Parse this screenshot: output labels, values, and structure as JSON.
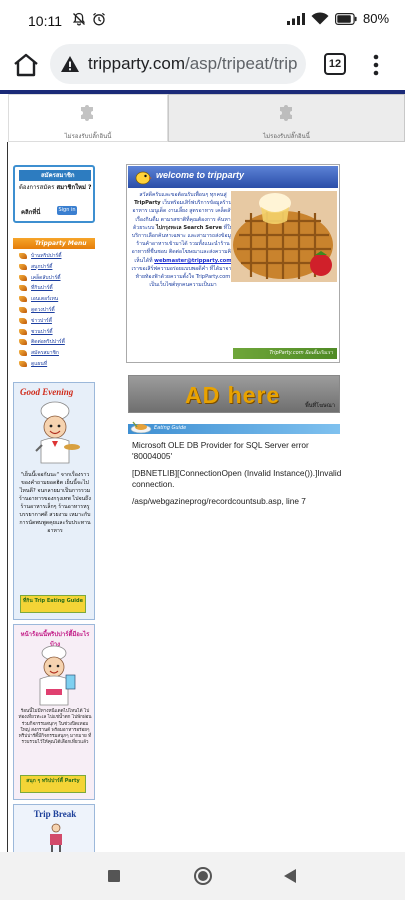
{
  "status_bar": {
    "time": "10:11",
    "battery": "80"
  },
  "browser": {
    "url_host": "tripparty.com",
    "url_path": "/asp/tripeat/trip",
    "tab_count": "12"
  },
  "plugin_notice": {
    "left": "ไม่รองรับปลั๊กอินนี้",
    "right": "ไม่รองรับปลั๊กอินนี้"
  },
  "member": {
    "title": "สมัครสมาชิก",
    "line": "ต้องการสมัคร",
    "line_bold": "สมาชิกใหม่ ?",
    "click": "คลิกที่นี่",
    "signin": "Sign in"
  },
  "menu": {
    "header": "Tripparty Menu",
    "items": [
      "บ้านทริปปาร์ตี้",
      "สนุกปาร์ตี้",
      "เคล็ดลับปาร์ตี้",
      "ที่กินปาร์ตี้",
      "เอนเตอร์เทน",
      "ดูดวงปาร์ตี้",
      "ข่าวปาร์ตี้",
      "ชวนปาร์ตี้",
      "ติดต่อทริปปาร์ตี้",
      "สมัครสมาชิก",
      "ดูแผนที่"
    ]
  },
  "ad_good_evening": {
    "title": "Good Evening",
    "text": "\"เย็นนี้เจอกันนะ\" จากเรื่องราวของคำถามยอดฮิต เย็นนี้จะไปไหนดี? จนกลายมาเป็นการรวมร้านอาหารของกรุงเทพ ไปจนถึงร้านอาหารเล็กๆ ร้านอาหารหรู บรรยากาศดี สวยงาม เหมาะกับการนัดพบพูดคุยและรับประทานอาหาร",
    "badge": "ที่กิน Trip Eating Guide"
  },
  "ad_party": {
    "title": "หน้าร้อนนี้ทริปปาร์ตี้มีอะไรบ้าง",
    "text": "ร้อนนี้ไม่มีทางหนีแดดไปไหนได้ ไปท่องเที่ยวทะเล ไปแช่น้ำตก ไปพักผ่อน ร่วมกิจกรรมสนุกๆ ในช่วงปิดเทอมใหญ่ สงกรานต์ พร้อมอาหารอร่อยๆ ทริปปาร์ตี้มีกิจกรรมสนุกๆ มากมาย ที่รวบรวมไว้ให้คุณได้เลือกเที่ยวแล้ว",
    "badge": "สนุก ๆ ทริปปาร์ตี้ Party"
  },
  "ad_trip_break": {
    "title": "Trip Break"
  },
  "welcome": {
    "header": "welcome to tripparty",
    "text_1": "สวัสดีครับและขอต้อนรับเพื่อนๆ ทุกคนสู่",
    "brand": "TripParty",
    "text_2": "เว็บพร้อมเสิร์ฟบริการข้อมูลร้านอาหาร เมนูเด็ด งานเลี้ยง สูตรอาหาร เคล็ดลับเรื่องกินดื่ม ตามรสชาติที่คุณต้องการ ค้นหาด้วยระบบ",
    "search_label": "ไปกรุงทะเล Search Serve",
    "text_3": "ที่ให้บริการเลือกค้นหาเฉพาะ และสามารถส่งข้อมูลร้านค้าอาหารเข้ามาได้ รวมทั้งแนะนำร้านอาหารที่ชื่นชอบ ติดต่อโฆษณาและส่งความคิดเห็นได้ที่",
    "email": "webmaster@tripparty.com",
    "text_4": "เราขอเสิร์ฟความอร่อยแบบพอดีคำ ที่ได้มาจากท้ายท้องฟ้าด้วยความตั้งใจ TripParty.com เป็นเว็บไซต์ทุกคนความเป็นมา",
    "footer": "TripParty.com ผิดเต็มกับเรา"
  },
  "ad_here": {
    "title": "AD here",
    "subtitle": "พื้นที่โฆษณา"
  },
  "eating_guide": {
    "label": "Eating Guide"
  },
  "error": {
    "line1": "Microsoft OLE DB Provider for SQL Server error '80004005'",
    "line2": "[DBNETLIB][ConnectionOpen (Invalid Instance()).]Invalid connection.",
    "line3": "/asp/webgazineprog/recordcountsub.asp, line 7"
  }
}
